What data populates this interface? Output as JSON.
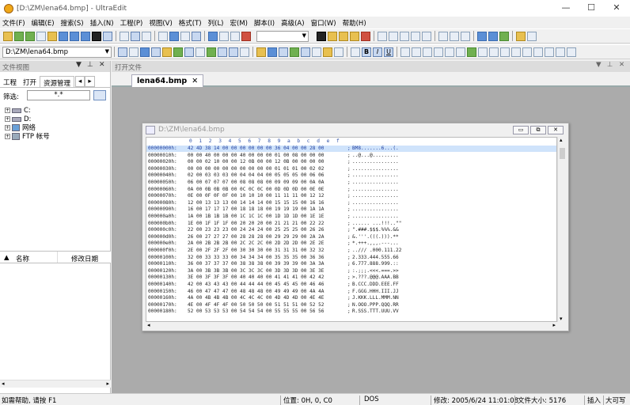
{
  "window": {
    "title": "[D:\\ZM\\lena64.bmp] - UltraEdit",
    "min": "—",
    "max": "☐",
    "close": "✕"
  },
  "menu": [
    "文件(F)",
    "编辑(E)",
    "搜索(S)",
    "插入(N)",
    "工程(P)",
    "视图(V)",
    "格式(T)",
    "列(L)",
    "宏(M)",
    "脚本(I)",
    "高级(A)",
    "窗口(W)",
    "帮助(H)"
  ],
  "toolbar": {
    "path_combo": "D:\\ZM\\lena64.bmp",
    "fmt_b": "B",
    "fmt_i": "I",
    "fmt_u": "U"
  },
  "left_pane": {
    "title": "文件视图",
    "tabs": [
      "工程",
      "打开",
      "资源管理"
    ],
    "filter_label": "筛选:",
    "filter_value": "*.*",
    "tree": [
      "C:",
      "D:",
      "网络",
      "FTP 帐号"
    ],
    "list_cols": [
      "名称",
      "修改日期"
    ]
  },
  "mdi": {
    "title": "打开文件",
    "tab_label": "lena64.bmp",
    "child_title": "D:\\ZM\\lena64.bmp",
    "ruler": [
      "0",
      "1",
      "2",
      "3",
      "4",
      "5",
      "6",
      "7",
      "8",
      "9",
      "a",
      "b",
      "c",
      "d",
      "e",
      "f"
    ],
    "hex_rows": [
      {
        "addr": "00000000h:",
        "hex": "42 4D 38 14 00 00 00 00 00 00 36 04 00 00 28 00",
        "sep": ";",
        "ascii": "BM8.......6...(."
      },
      {
        "addr": "00000010h:",
        "hex": "00 00 40 00 00 00 40 00 00 00 01 00 08 00 00 00",
        "sep": ";",
        "ascii": "..@...@........."
      },
      {
        "addr": "00000020h:",
        "hex": "00 00 02 10 00 00 12 0B 00 00 12 0B 00 00 00 00",
        "sep": ";",
        "ascii": "................"
      },
      {
        "addr": "00000030h:",
        "hex": "00 00 00 00 00 00 00 00 00 00 01 01 01 00 02 02",
        "sep": ";",
        "ascii": "................"
      },
      {
        "addr": "00000040h:",
        "hex": "02 00 03 03 03 00 04 04 04 00 05 05 05 00 06 06",
        "sep": ";",
        "ascii": "................"
      },
      {
        "addr": "00000050h:",
        "hex": "06 00 07 07 07 00 08 08 08 00 09 09 09 00 0A 0A",
        "sep": ";",
        "ascii": "................"
      },
      {
        "addr": "00000060h:",
        "hex": "0A 00 0B 0B 0B 00 0C 0C 0C 00 0D 0D 0D 00 0E 0E",
        "sep": ";",
        "ascii": "................"
      },
      {
        "addr": "00000070h:",
        "hex": "0E 00 0F 0F 0F 00 10 10 10 00 11 11 11 00 12 12",
        "sep": ";",
        "ascii": "................"
      },
      {
        "addr": "00000080h:",
        "hex": "12 00 13 13 13 00 14 14 14 00 15 15 15 00 16 16",
        "sep": ";",
        "ascii": "................"
      },
      {
        "addr": "00000090h:",
        "hex": "16 00 17 17 17 00 18 18 18 00 19 19 19 00 1A 1A",
        "sep": ";",
        "ascii": "................"
      },
      {
        "addr": "000000a0h:",
        "hex": "1A 00 1B 1B 1B 00 1C 1C 1C 00 1D 1D 1D 00 1E 1E",
        "sep": ";",
        "ascii": "................"
      },
      {
        "addr": "000000b0h:",
        "hex": "1E 00 1F 1F 1F 00 20 20 20 00 21 21 21 00 22 22",
        "sep": ";",
        "ascii": "...... ...!!!..\"\""
      },
      {
        "addr": "000000c0h:",
        "hex": "22 00 23 23 23 00 24 24 24 00 25 25 25 00 26 26",
        "sep": ";",
        "ascii": "\".###.$$$.%%%.&&"
      },
      {
        "addr": "000000d0h:",
        "hex": "26 00 27 27 27 00 28 28 28 00 29 29 29 00 2A 2A",
        "sep": ";",
        "ascii": "&.'''.(((.))).**"
      },
      {
        "addr": "000000e0h:",
        "hex": "2A 00 2B 2B 2B 00 2C 2C 2C 00 2D 2D 2D 00 2E 2E",
        "sep": ";",
        "ascii": "*.+++.,,,.---..."
      },
      {
        "addr": "000000f0h:",
        "hex": "2E 00 2F 2F 2F 00 30 30 30 00 31 31 31 00 32 32",
        "sep": ";",
        "ascii": "../// .000.111.22"
      },
      {
        "addr": "00000100h:",
        "hex": "32 00 33 33 33 00 34 34 34 00 35 35 35 00 36 36",
        "sep": ";",
        "ascii": "2.333.444.555.66"
      },
      {
        "addr": "00000110h:",
        "hex": "36 00 37 37 37 00 38 38 38 00 39 39 39 00 3A 3A",
        "sep": ";",
        "ascii": "6.777.888.999.::"
      },
      {
        "addr": "00000120h:",
        "hex": "3A 00 3B 3B 3B 00 3C 3C 3C 00 3D 3D 3D 00 3E 3E",
        "sep": ";",
        "ascii": ":.;;;.<<<.===.>>"
      },
      {
        "addr": "00000130h:",
        "hex": "3E 00 3F 3F 3F 00 40 40 40 00 41 41 41 00 42 42",
        "sep": ";",
        "ascii": ">.???.@@@.AAA.BB"
      },
      {
        "addr": "00000140h:",
        "hex": "42 00 43 43 43 00 44 44 44 00 45 45 45 00 46 46",
        "sep": ";",
        "ascii": "B.CCC.DDD.EEE.FF"
      },
      {
        "addr": "00000150h:",
        "hex": "46 00 47 47 47 00 48 48 48 00 49 49 49 00 4A 4A",
        "sep": ";",
        "ascii": "F.GGG.HHH.III.JJ"
      },
      {
        "addr": "00000160h:",
        "hex": "4A 00 4B 4B 4B 00 4C 4C 4C 00 4D 4D 4D 00 4E 4E",
        "sep": ";",
        "ascii": "J.KKK.LLL.MMM.NN"
      },
      {
        "addr": "00000170h:",
        "hex": "4E 00 4F 4F 4F 00 50 50 50 00 51 51 51 00 52 52",
        "sep": ";",
        "ascii": "N.OOO.PPP.QQQ.RR"
      },
      {
        "addr": "00000180h:",
        "hex": "52 00 53 53 53 00 54 54 54 00 55 55 55 00 56 56",
        "sep": ";",
        "ascii": "R.SSS.TTT.UUU.VV"
      }
    ]
  },
  "status": {
    "help": "如需帮助, 请按 F1",
    "pos": "位置: 0H, 0, C0",
    "mode": "DOS",
    "modified": "修改: 2005/6/24 11:01:08",
    "size": "文件大小: 5176",
    "insert": "插入",
    "write": "大可写"
  }
}
